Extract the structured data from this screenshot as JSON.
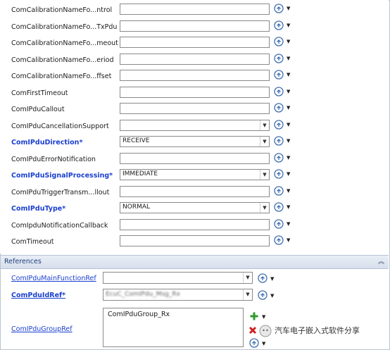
{
  "parameters": [
    {
      "label": "ComCalibrationNameFo...ntrol",
      "required": false,
      "type": "text",
      "value": ""
    },
    {
      "label": "ComCalibrationNameFo...TxPdu",
      "required": false,
      "type": "text",
      "value": ""
    },
    {
      "label": "ComCalibrationNameFo...meout",
      "required": false,
      "type": "text",
      "value": ""
    },
    {
      "label": "ComCalibrationNameFo...eriod",
      "required": false,
      "type": "text",
      "value": ""
    },
    {
      "label": "ComCalibrationNameFo...ffset",
      "required": false,
      "type": "text",
      "value": ""
    },
    {
      "label": "ComFirstTimeout",
      "required": false,
      "type": "text",
      "value": ""
    },
    {
      "label": "ComIPduCallout",
      "required": false,
      "type": "text",
      "value": ""
    },
    {
      "label": "ComIPduCancellationSupport",
      "required": false,
      "type": "combo",
      "value": ""
    },
    {
      "label": "ComIPduDirection*",
      "required": true,
      "type": "combo",
      "value": "RECEIVE"
    },
    {
      "label": "ComIPduErrorNotification",
      "required": false,
      "type": "text",
      "value": ""
    },
    {
      "label": "ComIPduSignalProcessing*",
      "required": true,
      "type": "combo",
      "value": "IMMEDIATE"
    },
    {
      "label": "ComIPduTriggerTransm...llout",
      "required": false,
      "type": "text",
      "value": ""
    },
    {
      "label": "ComIPduType*",
      "required": true,
      "type": "combo",
      "value": "NORMAL"
    },
    {
      "label": "ComIpduNotificationCallback",
      "required": false,
      "type": "text",
      "value": ""
    },
    {
      "label": "ComTimeout",
      "required": false,
      "type": "text",
      "value": ""
    }
  ],
  "references": {
    "title": "References",
    "main_function_ref": {
      "label": "ComIPduMainFunctionRef",
      "value": ""
    },
    "pdu_id_ref": {
      "label": "ComPduIdRef*",
      "value": "EcuC_ComIPdu_Msg_Rx"
    },
    "group_ref": {
      "label": "ComIPduGroupRef",
      "items": [
        "ComIPduGroup_Rx"
      ]
    }
  },
  "watermark": {
    "text": "汽车电子嵌入式软件分享"
  },
  "icons": {
    "reset": "reset-default-icon",
    "dropdown": "chevron-down-icon",
    "add": "add-plus-icon",
    "delete": "delete-x-icon",
    "collapse": "collapse-chevrons-icon"
  },
  "colors": {
    "required_label": "#1a3fd0",
    "section_header": "#d6dfec",
    "reset_icon": "#3f6fb0",
    "add_icon": "#2e9a2e",
    "delete_icon": "#d02020"
  }
}
